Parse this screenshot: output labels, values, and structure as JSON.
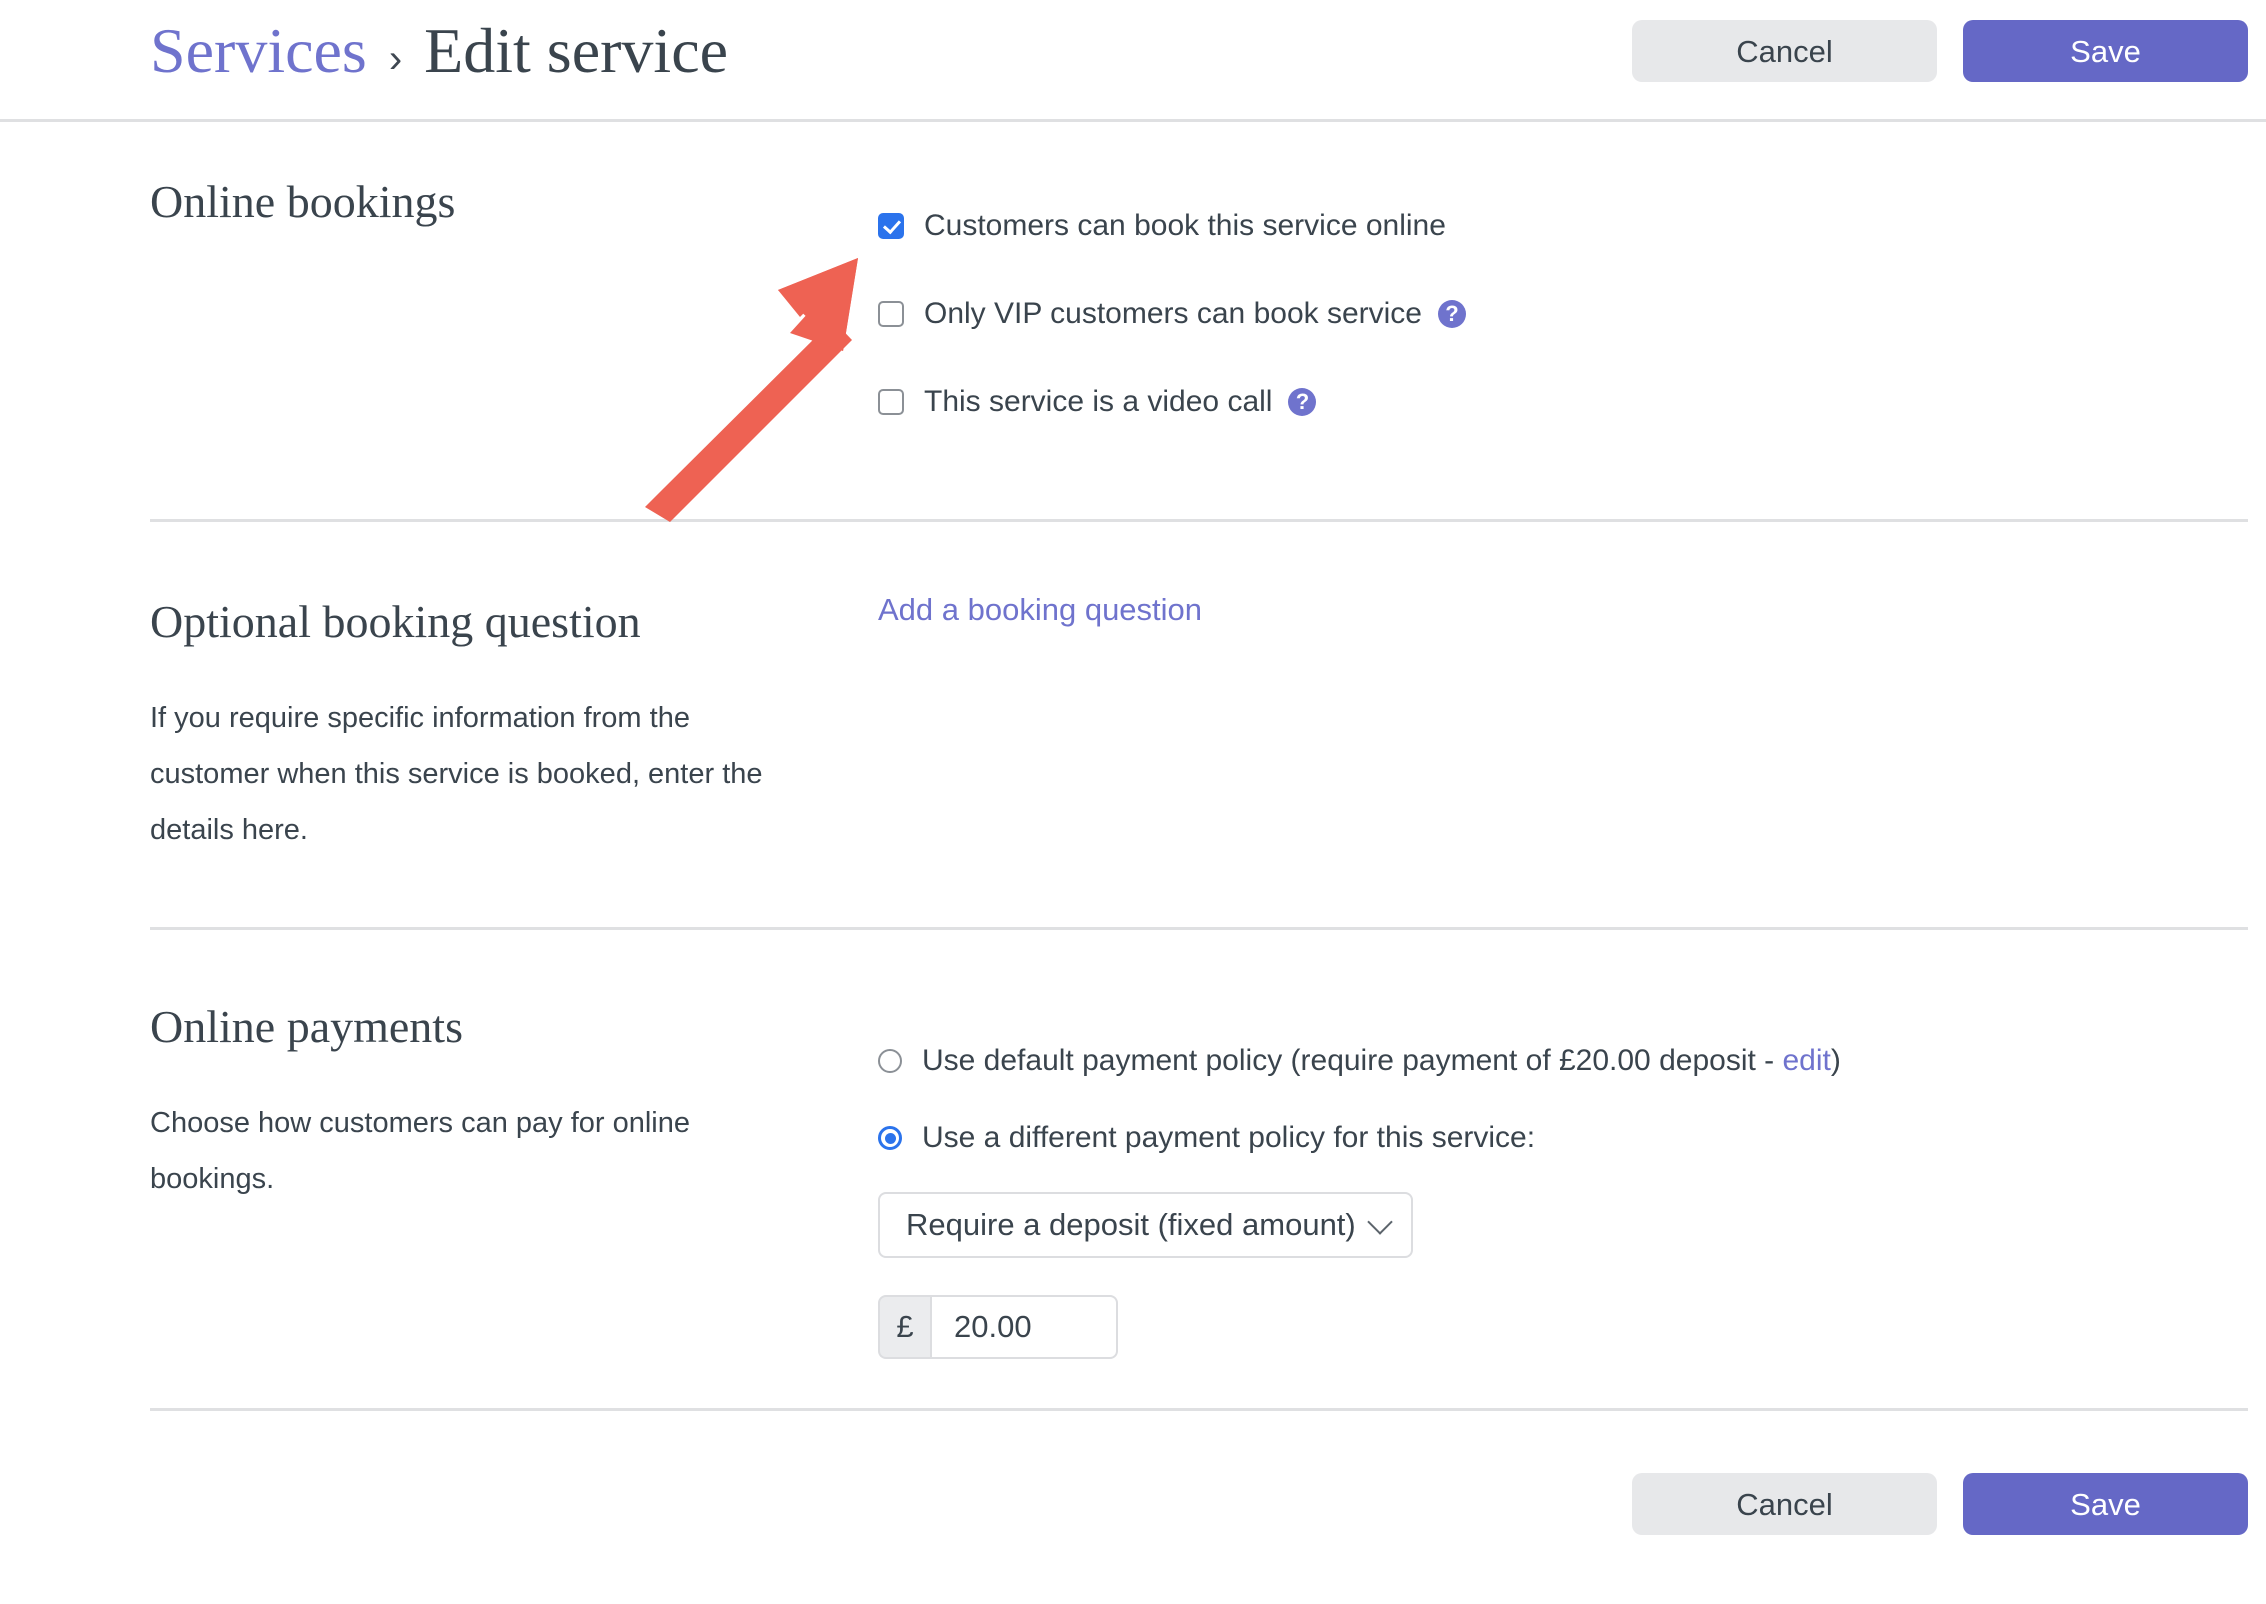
{
  "header": {
    "breadcrumb_parent": "Services",
    "breadcrumb_separator": "›",
    "breadcrumb_current": "Edit service",
    "cancel_label": "Cancel",
    "save_label": "Save"
  },
  "online_bookings": {
    "title": "Online bookings",
    "options": [
      {
        "label": "Customers can book this service online",
        "checked": true,
        "help": false,
        "help_glyph": "?"
      },
      {
        "label": "Only VIP customers can book service",
        "checked": false,
        "help": true,
        "help_glyph": "?"
      },
      {
        "label": "This service is a video call",
        "checked": false,
        "help": true,
        "help_glyph": "?"
      }
    ]
  },
  "optional_booking_question": {
    "title": "Optional booking question",
    "description": "If you require specific information from the customer when this service is booked, enter the details here.",
    "add_link_label": "Add a booking question"
  },
  "online_payments": {
    "title": "Online payments",
    "description": "Choose how customers can pay for online bookings.",
    "radio_default_prefix": "Use default payment policy (require payment of £20.00 deposit - ",
    "radio_default_link": "edit",
    "radio_default_suffix": ")",
    "radio_default_selected": false,
    "radio_different_label": "Use a different payment policy for this service:",
    "radio_different_selected": true,
    "policy_select_value": "Require a deposit (fixed amount)",
    "policy_select_icon": "chevron-down-icon",
    "currency_symbol": "£",
    "amount_value": "20.00"
  },
  "footer": {
    "cancel_label": "Cancel",
    "save_label": "Save"
  },
  "annotation": {
    "type": "arrow",
    "color": "#ee6253",
    "points_to": "customers-can-book-online-checkbox"
  },
  "colors": {
    "accent_purple": "#6568c6",
    "link_purple": "#6f73cd",
    "checkbox_blue": "#2b73ec",
    "text_dark": "#3a444d",
    "divider": "#dfe0e2",
    "cancel_grey": "#e7e8ea",
    "annotation_red": "#ee6253"
  }
}
